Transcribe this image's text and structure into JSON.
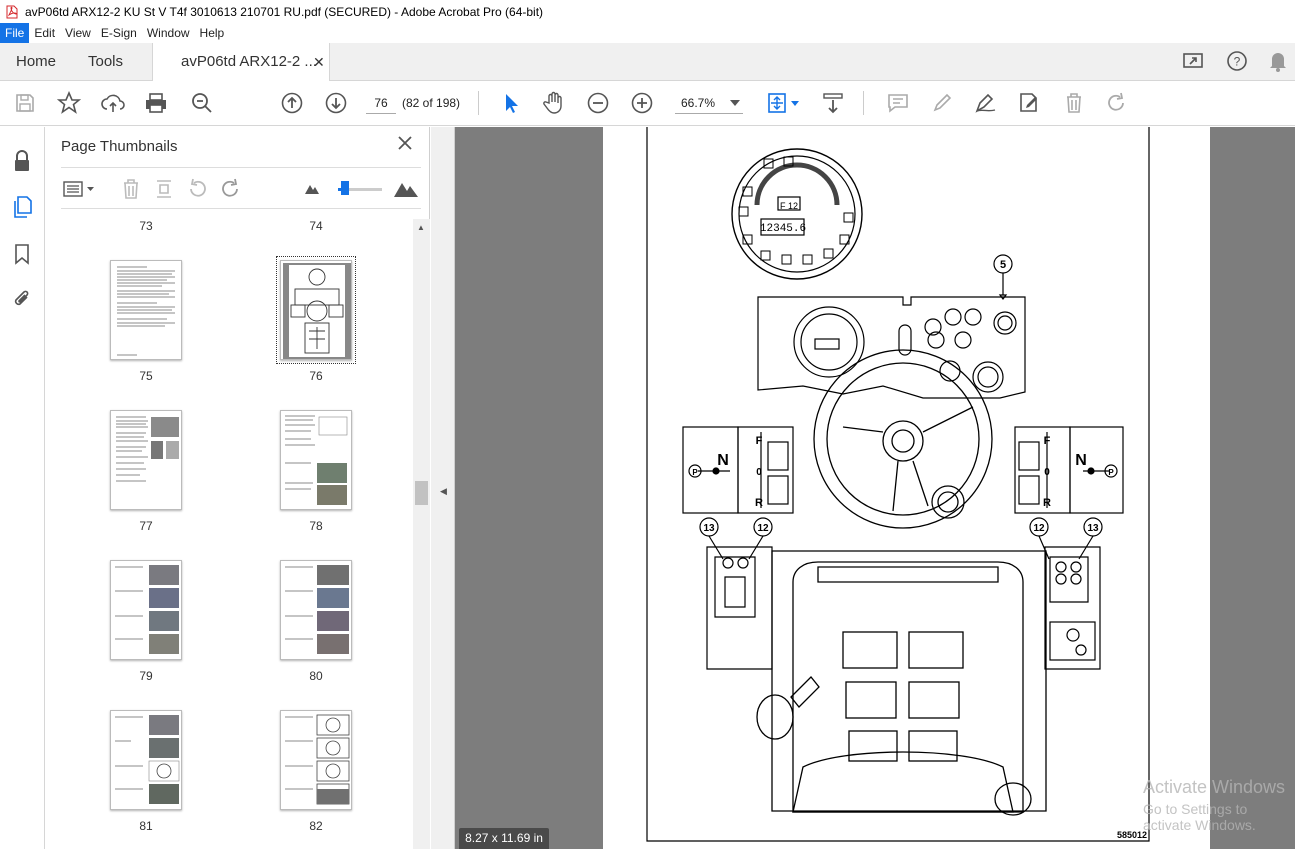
{
  "window": {
    "title": "avP06td ARX12-2 KU St V T4f 3010613 210701 RU.pdf (SECURED) - Adobe Acrobat Pro (64-bit)"
  },
  "menu": [
    "File",
    "Edit",
    "View",
    "E-Sign",
    "Window",
    "Help"
  ],
  "tabs": {
    "home": "Home",
    "tools": "Tools",
    "doc": "avP06td ARX12-2 ..."
  },
  "toolbar": {
    "page_current": "76",
    "page_of": "(82 of 198)",
    "zoom": "66.7%"
  },
  "panel": {
    "title": "Page Thumbnails"
  },
  "thumbnails": {
    "n73": "73",
    "n74": "74",
    "n75": "75",
    "n76": "76",
    "n77": "77",
    "n78": "78",
    "n79": "79",
    "n80": "80",
    "n81": "81",
    "n82": "82"
  },
  "status": {
    "page_size": "8.27 x 11.69 in"
  },
  "document": {
    "figure_code": "585012",
    "callout_5": "5",
    "callout_13a": "13",
    "callout_12a": "12",
    "callout_12b": "12",
    "callout_13b": "13",
    "display_gear": "F 12",
    "display_hours": "12345.6",
    "shift_f": "F",
    "shift_n": "N",
    "shift_0": "0",
    "shift_r": "R",
    "shift_p": "P"
  },
  "watermark": {
    "line1": "Activate Windows",
    "line2": "Go to Settings to activate Windows."
  },
  "colors": {
    "accent": "#1473e6",
    "doc_bg": "#7d7d7d",
    "tool_gray": "#555555"
  }
}
